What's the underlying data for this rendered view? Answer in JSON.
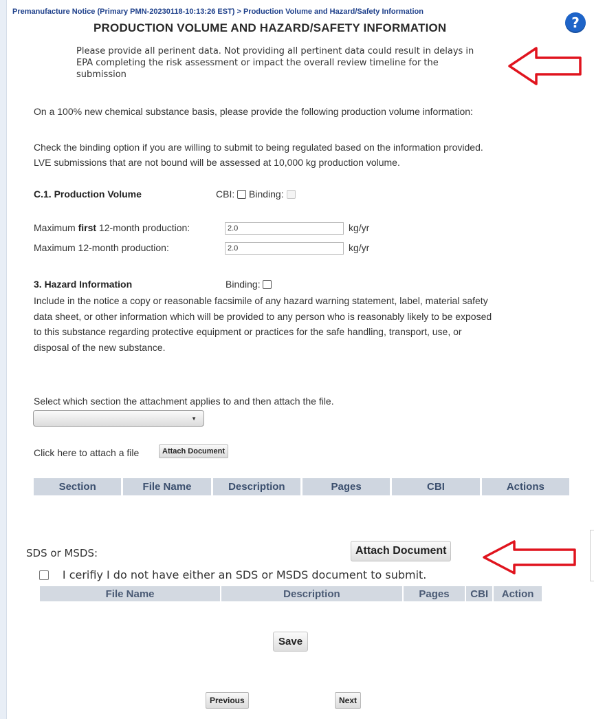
{
  "header": {
    "breadcrumb": "Premanufacture Notice (Primary PMN-20230118-10:13:26 EST) > Production Volume and Hazard/Safety Information",
    "title": "PRODUCTION VOLUME AND HAZARD/SAFETY INFORMATION",
    "help_glyph": "?"
  },
  "notice": {
    "line1": "Please provide all perinent data. Not providing all pertinent data could result in delays in",
    "line2": "EPA completing the risk assessment or impact the overall review timeline for the",
    "line3": "submission"
  },
  "intro": {
    "basis": "On a 100% new chemical substance basis, please provide the following production volume information:",
    "binding_line1": "Check the binding option if you are willing to submit to being regulated based on the information provided.",
    "binding_line2": "LVE submissions that are not bound will be assessed at 10,000 kg production volume."
  },
  "production_volume": {
    "heading": "C.1. Production Volume",
    "cbi_label": "CBI:",
    "binding_label": "Binding:",
    "first_label_pre": "Maximum ",
    "first_label_bold": "first",
    "first_label_post": " 12-month production:",
    "first_value": "2.0",
    "max_label": "Maximum 12-month production:",
    "max_value": "2.0",
    "unit": "kg/yr"
  },
  "hazard": {
    "heading": "3. Hazard Information",
    "binding_label": "Binding:",
    "line1": "Include in the notice a copy or reasonable facsimile of any hazard warning statement, label, material safety",
    "line2": "data sheet, or other information which will be provided to any person who is reasonably likely to be exposed",
    "line3": "to this substance regarding protective equipment or practices for the safe handling, transport, use, or",
    "line4": "disposal of the new substance."
  },
  "attachment": {
    "select_instruction": "Select which section the attachment applies to and then attach the file.",
    "select_value": "",
    "attach_prompt": "Click here to attach a file",
    "attach_button": "Attach Document",
    "table_headers": [
      "Section",
      "File Name",
      "Description",
      "Pages",
      "CBI",
      "Actions"
    ]
  },
  "sds": {
    "label": "SDS or MSDS:",
    "attach_button": "Attach Document",
    "certify_text": "I cerifiy I do not have either an SDS or MSDS document to submit.",
    "table_headers": [
      "File Name",
      "Description",
      "Pages",
      "CBI",
      "Action"
    ]
  },
  "footer": {
    "save": "Save",
    "previous": "Previous",
    "next": "Next"
  },
  "colors": {
    "annotation_arrow": "#e0141e",
    "help_icon": "#1e64c8",
    "breadcrumb": "#1d3f8a",
    "table_header_bg": "#cfd6e0"
  }
}
